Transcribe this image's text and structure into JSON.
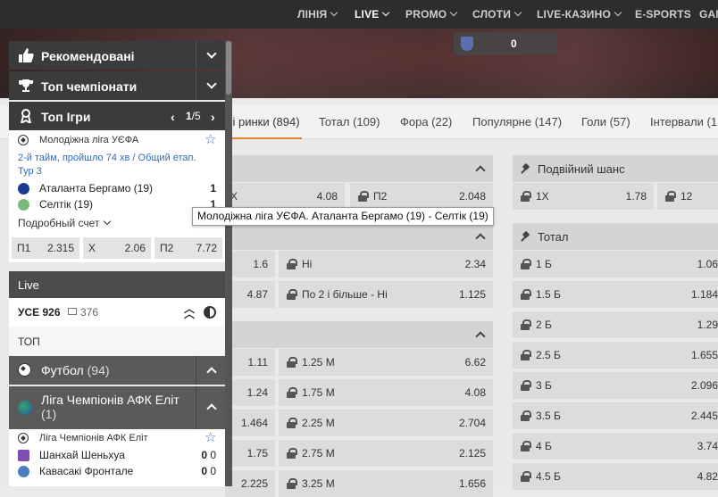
{
  "topnav": {
    "items": [
      {
        "label": "ЛІНІЯ"
      },
      {
        "label": "LIVE"
      },
      {
        "label": "PROMO"
      },
      {
        "label": "СЛОТИ"
      },
      {
        "label": "LIVE-КАЗИНО"
      },
      {
        "label": "E-SPORTS"
      },
      {
        "label": "GAM"
      }
    ]
  },
  "score": {
    "value": "0"
  },
  "market_tabs": [
    {
      "label": "сі ринки (894)"
    },
    {
      "label": "Тотал (109)"
    },
    {
      "label": "Фора (22)"
    },
    {
      "label": "Популярне (147)"
    },
    {
      "label": "Голи (57)"
    },
    {
      "label": "Інтервали (1"
    }
  ],
  "sidebar": {
    "sections": [
      {
        "label": "Рекомендовані",
        "icon": "thumbs-up-icon"
      },
      {
        "label": "Топ чемпіонати",
        "icon": "trophy-icon"
      }
    ],
    "top_games": {
      "label": "Топ Ігри",
      "icon": "award-icon",
      "page": "1",
      "pages": "/5"
    },
    "game": {
      "league": "Молодіжна ліга УЄФА",
      "status": "2-й тайм, пройшло 74 хв / Общий етап. Тур 3",
      "team1": {
        "name": "Аталанта Бергамо (19)",
        "score": "1"
      },
      "team2": {
        "name": "Селтік (19)",
        "score": "1"
      },
      "more_label": "Подробный счет",
      "odds": [
        {
          "k": "П1",
          "v": "2.315"
        },
        {
          "k": "X",
          "v": "2.06"
        },
        {
          "k": "П2",
          "v": "7.72"
        }
      ]
    },
    "live_label": "Live",
    "all": {
      "label": "УСЕ 926",
      "count": "376"
    },
    "top_label": "ТОП",
    "sport": {
      "label": "Футбол",
      "count": "(94)"
    },
    "league": {
      "label": "Ліга Чемпіонів АФК Еліт",
      "count": "(1)"
    },
    "match2": {
      "league": "Ліга Чемпіонів АФК Еліт",
      "team1": {
        "name": "Шанхай Шеньхуа",
        "s1": "0",
        "s2": "0"
      },
      "team2": {
        "name": "Кавасакі Фронтале",
        "s1": "0",
        "s2": "0"
      }
    }
  },
  "tooltip": "Молодіжна ліга УЄФА. Аталанта Бергамо (19) - Селтік (19)",
  "left_cards": {
    "card1": {
      "cells": [
        {
          "k": "X",
          "v": "4.08"
        },
        {
          "k": "П2",
          "v": "2.048"
        }
      ]
    },
    "card2": {
      "cells": [
        {
          "k": "",
          "v": "1.6"
        },
        {
          "k": "Ні",
          "v": "2.34"
        },
        {
          "k": "",
          "v": "4.87"
        },
        {
          "k": "По 2 і більше - Ні",
          "v": "1.125"
        }
      ]
    },
    "card3": {
      "rows": [
        {
          "a": "1.11",
          "k": "1.25 М",
          "v": "6.62"
        },
        {
          "a": "1.24",
          "k": "1.75 М",
          "v": "4.08"
        },
        {
          "a": "1.464",
          "k": "2.25 М",
          "v": "2.704"
        },
        {
          "a": "1.75",
          "k": "2.75 М",
          "v": "2.125"
        },
        {
          "a": "2.225",
          "k": "3.25 М",
          "v": "1.656"
        }
      ]
    }
  },
  "right_cards": {
    "double_chance": {
      "title": "Подвійний шанс",
      "cells": [
        {
          "k": "1X",
          "v": "1.78"
        },
        {
          "k": "12",
          "v": ""
        }
      ]
    },
    "total": {
      "title": "Тотал",
      "rows": [
        {
          "k": "1 Б",
          "v": "1.06"
        },
        {
          "k": "1.5 Б",
          "v": "1.184"
        },
        {
          "k": "2 Б",
          "v": "1.29"
        },
        {
          "k": "2.5 Б",
          "v": "1.655"
        },
        {
          "k": "3 Б",
          "v": "2.096"
        },
        {
          "k": "3.5 Б",
          "v": "2.445"
        },
        {
          "k": "4 Б",
          "v": "3.74"
        },
        {
          "k": "4.5 Б",
          "v": "4.82"
        }
      ]
    }
  }
}
